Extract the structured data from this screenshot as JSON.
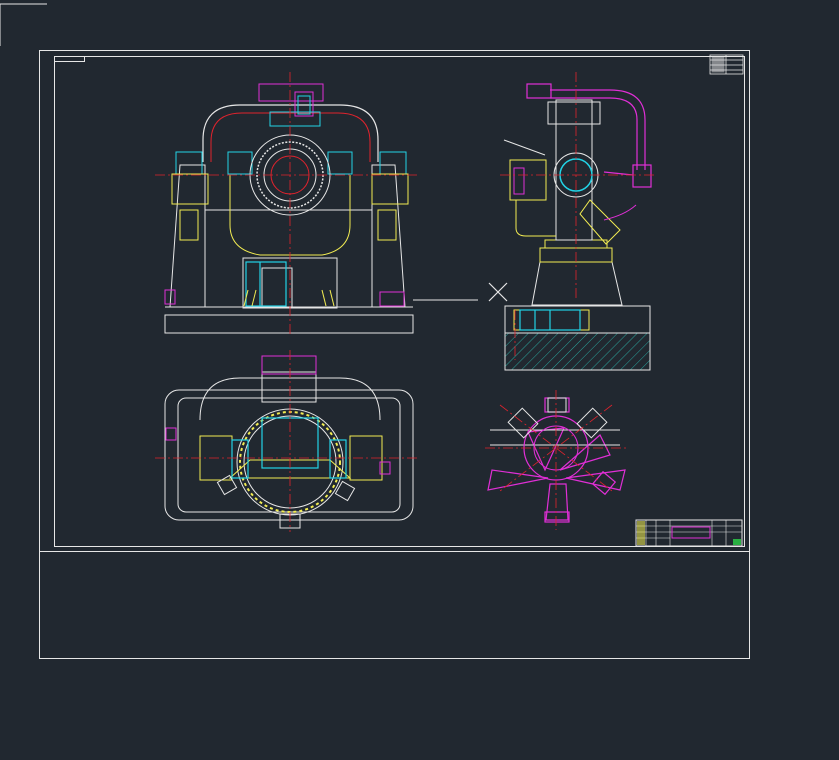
{
  "app": {
    "view": "model-space",
    "background": "#212830"
  },
  "drawing": {
    "title_block_text": "",
    "note_text": "",
    "layer_colors": {
      "outline": "#e6e6e6",
      "centerline": "#e0232d",
      "cyan": "#22d3e6",
      "magenta": "#e02fd6",
      "yellow": "#f2ec52",
      "green": "#2ee84a",
      "hatch": "#2aa39a"
    },
    "views": [
      {
        "id": "front-view",
        "label": ""
      },
      {
        "id": "side-view",
        "label": ""
      },
      {
        "id": "top-view",
        "label": ""
      },
      {
        "id": "section-view",
        "label": ""
      }
    ]
  }
}
